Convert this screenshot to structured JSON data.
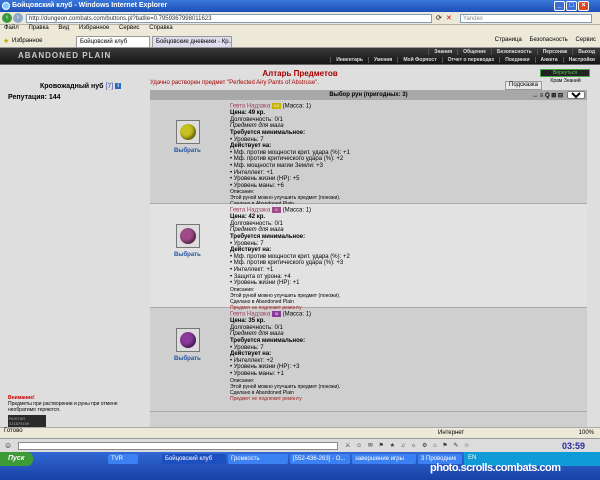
{
  "window": {
    "title": "Бойцовский клуб - Windows Internet Explorer"
  },
  "browser": {
    "url": "http://dungeon.combats.com/buttons.pl?batlle=0.7959367998011623",
    "search_placeholder": "Yandex",
    "menu": [
      "Файл",
      "Правка",
      "Вид",
      "Избранное",
      "Сервис",
      "Справка"
    ],
    "favorites_label": "Избранное",
    "tabs": [
      "Бойцовский клуб",
      "Бойцовские дневники - Кр..."
    ],
    "toolbar_right": [
      "Страница",
      "Безопасность",
      "Сервис"
    ]
  },
  "game": {
    "logo": "ABANDONED PLAIN",
    "nav_top": [
      "Знания",
      "Общение",
      "Безопасность",
      "Персонаж",
      "Выход"
    ],
    "nav_bottom": [
      "Инвентарь",
      "Умения",
      "Мой Форпост",
      "Отчет о переводах",
      "Поединки",
      "Анкета",
      "Настройки"
    ],
    "player": {
      "name": "Кровожадный нуб",
      "level": "[7]",
      "info_icon": "i"
    },
    "reputation": "Репутация: 144",
    "title": "Алтарь Предметов",
    "message": "Удачно растворен предмет \"Perfected Airy Pants of Abstruse\".",
    "hint_button": "Подсказка",
    "back_button": "Вернуться",
    "guard_label": "Храм Знаний",
    "panel_header": "Выбор рун (пригодных: 3)",
    "panel_tools": "↔ ≡ Q ⊞ ⊟",
    "filter_select": "Все",
    "items": [
      {
        "name": "Гевта Надзака",
        "badge": "VII",
        "weight": "(Масса: 1)",
        "price": "Цена: 49 кр.",
        "durability": "Долговечность: 0/1",
        "for": "Предмет для мага",
        "req_head": "Требуется минимальное:",
        "reqs": [
          "• Уровень: 7"
        ],
        "acts_head": "Действует на:",
        "acts": [
          "• Мф. против мощности крит. удара (%): +1",
          "• Мф. против критического удара (%): +2",
          "• Мф. мощности магии Земли: +3",
          "• Интеллект: +1",
          "• Уровень жизни (HP): +5",
          "• Уровень маны: +6"
        ],
        "desc_head": "Описание:",
        "desc": "Этой руной можно улучшить предмет (поножи).",
        "made": "Сделано в Abandoned Plain",
        "repair": "Предмет не подлежит ремонту",
        "select": "Выбрать",
        "stone_color": "#c8c020"
      },
      {
        "name": "Гевта Надзака",
        "badge": "II",
        "weight": "(Масса: 1)",
        "price": "Цена: 42 кр.",
        "durability": "Долговечность: 0/1",
        "for": "Предмет для мага",
        "req_head": "Требуется минимальное:",
        "reqs": [
          "• Уровень: 7"
        ],
        "acts_head": "Действует на:",
        "acts": [
          "• Мф. против мощности крит. удара (%): +2",
          "• Мф. против критического удара (%): +3",
          "• Интеллект: +1",
          "• Защита от урона: +4",
          "• Уровень жизни (HP): +1"
        ],
        "desc_head": "Описание:",
        "desc": "Этой руной можно улучшить предмет (поножи).",
        "made": "Сделано в Abandoned Plain",
        "repair": "Предмет не подлежит ремонту",
        "select": "Выбрать",
        "stone_color": "#a04a8a"
      },
      {
        "name": "Гевта Надзака",
        "badge": "III",
        "weight": "(Масса: 1)",
        "price": "Цена: 35 кр.",
        "durability": "Долговечность: 0/1",
        "for": "Предмет для мага",
        "req_head": "Требуется минимальное:",
        "reqs": [
          "• Уровень: 7"
        ],
        "acts_head": "Действует на:",
        "acts": [
          "• Интеллект: +2",
          "• Уровень жизни (HP): +3",
          "• Уровень маны: +1"
        ],
        "desc_head": "Описание:",
        "desc": "Этой руной можно улучшить предмет (поножи).",
        "made": "Сделано в Abandoned Plain",
        "repair": "Предмет не подлежит ремонту",
        "select": "Выбрать",
        "stone_color": "#8a3a9a"
      }
    ],
    "warning_title": "Внимание!",
    "warning_text": "Предметы при растворении и руны при отмене необратимо теряются.",
    "counter": "RUSTAR 321879159"
  },
  "statusbar": {
    "status": "Готово",
    "zone": "Интернет",
    "zoom": "100%"
  },
  "gamebar": {
    "clock": "03:59",
    "icons": "⚔ ☺ ✉ ⚑ ★ ♫ ☼ ⚙ ⌂ ⚑ ✎ ☆"
  },
  "taskbar": {
    "start": "Пуск",
    "items": [
      "TVR",
      "Бойцовский клуб",
      "Громкость",
      "[552-436-263] - O...",
      "завершение игры",
      "3 Проводник"
    ],
    "lang": "EN",
    "watermark": "photo.scrolls.combats.com"
  },
  "colors": {
    "title_red": "#a50000",
    "link_blue": "#2455a5",
    "taskbar_blue": "#2458c4"
  }
}
